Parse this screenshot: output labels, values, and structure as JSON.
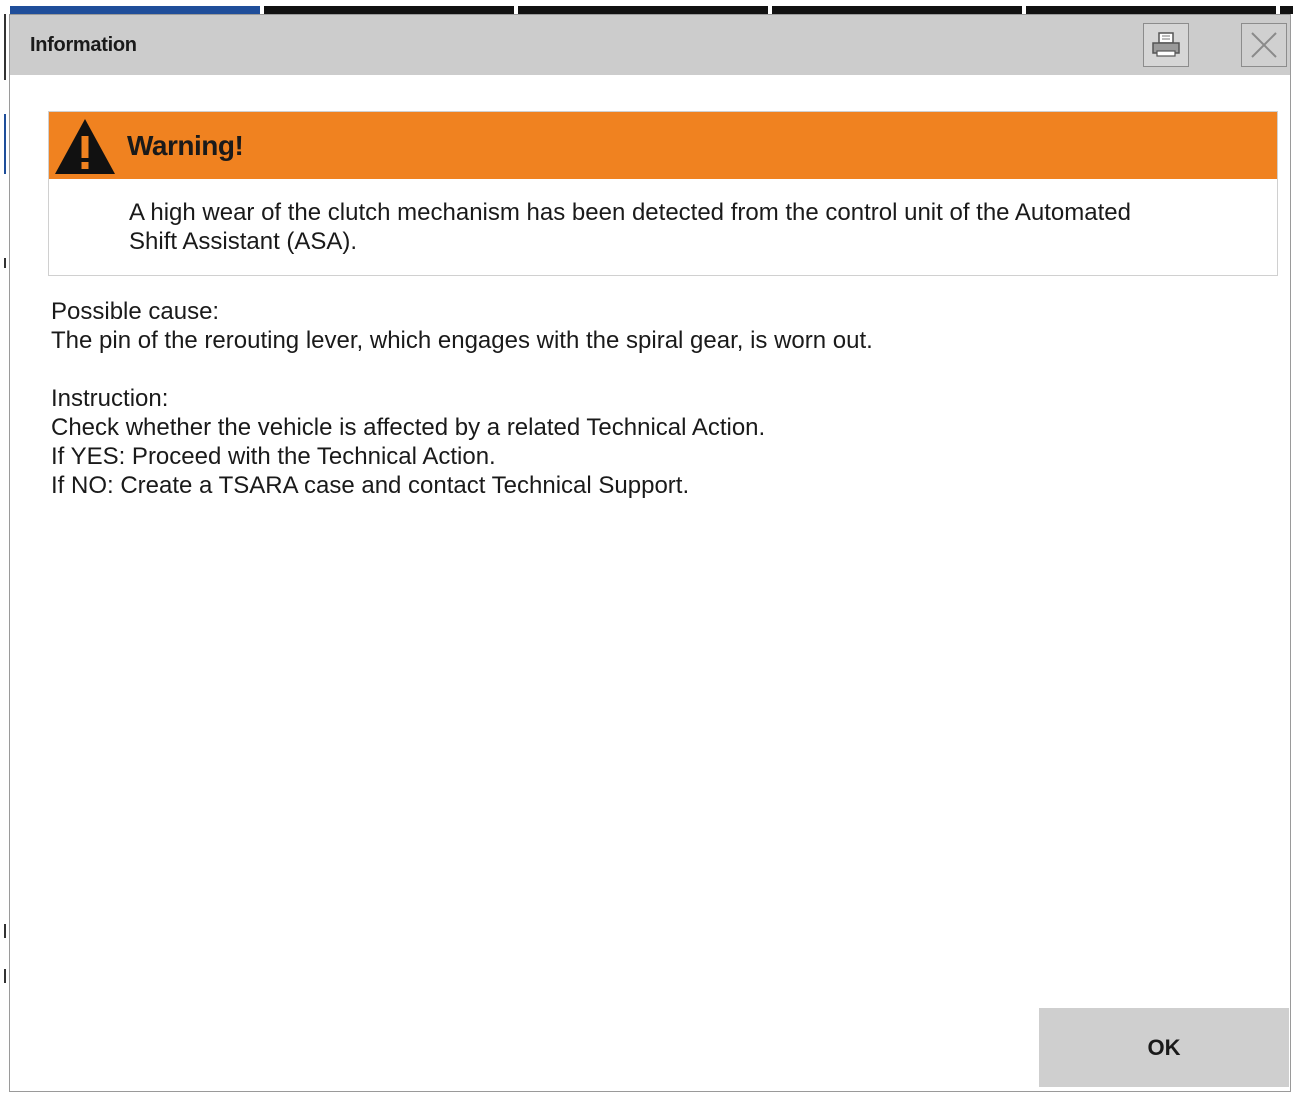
{
  "window": {
    "title": "Information",
    "print_icon": "print-icon",
    "close_icon": "close-icon"
  },
  "warning": {
    "icon": "warning-triangle-icon",
    "title": "Warning!",
    "message_line1": "A high wear of the clutch mechanism has been detected from the control unit of the Automated",
    "message_line2": "Shift Assistant (ASA)."
  },
  "cause": {
    "heading": "Possible cause:",
    "text": "The pin of the rerouting lever, which engages with the spiral gear, is worn out."
  },
  "instruction": {
    "heading": "Instruction:",
    "lines": [
      "Check whether the vehicle is affected by a related Technical Action.",
      "If YES: Proceed with the Technical Action.",
      "If NO: Create a TSARA case and contact Technical Support."
    ]
  },
  "footer": {
    "ok_label": "OK"
  },
  "colors": {
    "warning_header": "#f08220",
    "titlebar": "#cccccc",
    "ok_button": "#cfcfcf"
  }
}
